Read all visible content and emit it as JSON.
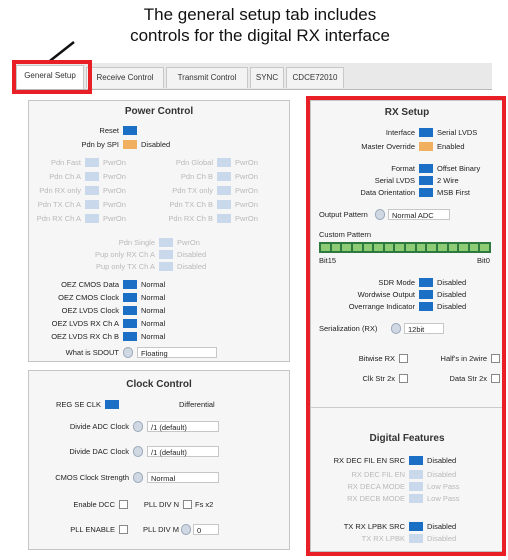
{
  "annotation": {
    "line1": "The general setup tab includes",
    "line2": "controls for the digital RX interface"
  },
  "colors": {
    "highlight": "#e81f26",
    "control_on": "#1b6fc4",
    "control_alt": "#f0b060",
    "bits": "#8dcc74"
  },
  "tabs": [
    "General Setup",
    "Receive Control",
    "Transmit Control",
    "SYNC",
    "CDCE72010"
  ],
  "power_control": {
    "title": "Power Control",
    "reset_label": "Reset",
    "pdn_spi_label": "Pdn by SPI",
    "pdn_spi_value": "Disabled",
    "faded_left": [
      {
        "label": "Pdn Fast",
        "value": "PwrOn"
      },
      {
        "label": "Pdn Ch A",
        "value": "PwrOn"
      },
      {
        "label": "Pdn RX only",
        "value": "PwrOn"
      },
      {
        "label": "Pdn TX Ch A",
        "value": "PwrOn"
      },
      {
        "label": "Pdn RX Ch A",
        "value": "PwrOn"
      }
    ],
    "faded_right": [
      {
        "label": "Pdn Global",
        "value": "PwrOn"
      },
      {
        "label": "Pdn Ch B",
        "value": "PwrOn"
      },
      {
        "label": "Pdn TX only",
        "value": "PwrOn"
      },
      {
        "label": "Pdn TX Ch B",
        "value": "PwrOn"
      },
      {
        "label": "Pdn RX Ch B",
        "value": "PwrOn"
      }
    ],
    "faded_center": [
      {
        "label": "Pdn Single",
        "value": "PwrOn"
      },
      {
        "label": "Pup only RX Ch A",
        "value": "Disabled"
      },
      {
        "label": "Pup only TX Ch A",
        "value": "Disabled"
      }
    ],
    "oez": [
      {
        "label": "OEZ CMOS Data",
        "value": "Normal"
      },
      {
        "label": "OEZ CMOS Clock",
        "value": "Normal"
      },
      {
        "label": "OEZ LVDS Clock",
        "value": "Normal"
      },
      {
        "label": "OEZ LVDS RX Ch A",
        "value": "Normal"
      },
      {
        "label": "OEZ LVDS RX Ch B",
        "value": "Normal"
      }
    ],
    "sdout_label": "What is SDOUT",
    "sdout_value": "Floating"
  },
  "clock_control": {
    "title": "Clock Control",
    "reg_se_clk_label": "REG SE CLK",
    "reg_se_clk_value": "Differential",
    "div_adc_label": "Divide ADC Clock",
    "div_adc_value": "/1 (default)",
    "div_dac_label": "Divide DAC Clock",
    "div_dac_value": "/1 (default)",
    "cmos_label": "CMOS Clock Strength",
    "cmos_value": "Normal",
    "enable_dcc_label": "Enable DCC",
    "pll_div_n_label": "PLL DIV N",
    "pll_div_n_value": "Fs x2",
    "pll_enable_label": "PLL ENABLE",
    "pll_div_m_label": "PLL DIV M",
    "pll_div_m_value": "0"
  },
  "rx_setup": {
    "title": "RX Setup",
    "interface_label": "Interface",
    "interface_value": "Serial LVDS",
    "master_override_label": "Master Override",
    "master_override_value": "Enabled",
    "format_label": "Format",
    "format_value": "Offset Binary",
    "serial_lvds_label": "Serial LVDS",
    "serial_lvds_value": "2 Wire",
    "data_orientation_label": "Data Orientation",
    "data_orientation_value": "MSB First",
    "output_pattern_label": "Output Pattern",
    "output_pattern_value": "Normal ADC",
    "custom_pattern_label": "Custom Pattern",
    "bit_high": "Bit15",
    "bit_low": "Bit0",
    "sdr_label": "SDR Mode",
    "sdr_value": "Disabled",
    "wordwise_label": "Wordwise Output",
    "wordwise_value": "Disabled",
    "overrange_label": "Overrange Indicator",
    "overrange_value": "Disabled",
    "serialization_label": "Serialization (RX)",
    "serialization_value": "12bit",
    "bitwise_label": "Bitwise RX",
    "halfx_label": "Half's in 2wire",
    "clkstr_label": "Clk Str 2x",
    "datastr_label": "Data Str 2x"
  },
  "digital_features": {
    "title": "Digital Features",
    "rx_dec_label": "RX DEC FIL EN SRC",
    "rx_dec_value": "Disabled",
    "faded": [
      {
        "label": "RX DEC FIL EN",
        "value": "Disabled"
      },
      {
        "label": "RX DECA MODE",
        "value": "Low Pass"
      },
      {
        "label": "RX DECB MODE",
        "value": "Low Pass"
      }
    ],
    "tx_rx_label": "TX RX LPBK SRC",
    "tx_rx_value": "Disabled",
    "faded2_label": "TX RX LPBK",
    "faded2_value": "Disabled"
  }
}
